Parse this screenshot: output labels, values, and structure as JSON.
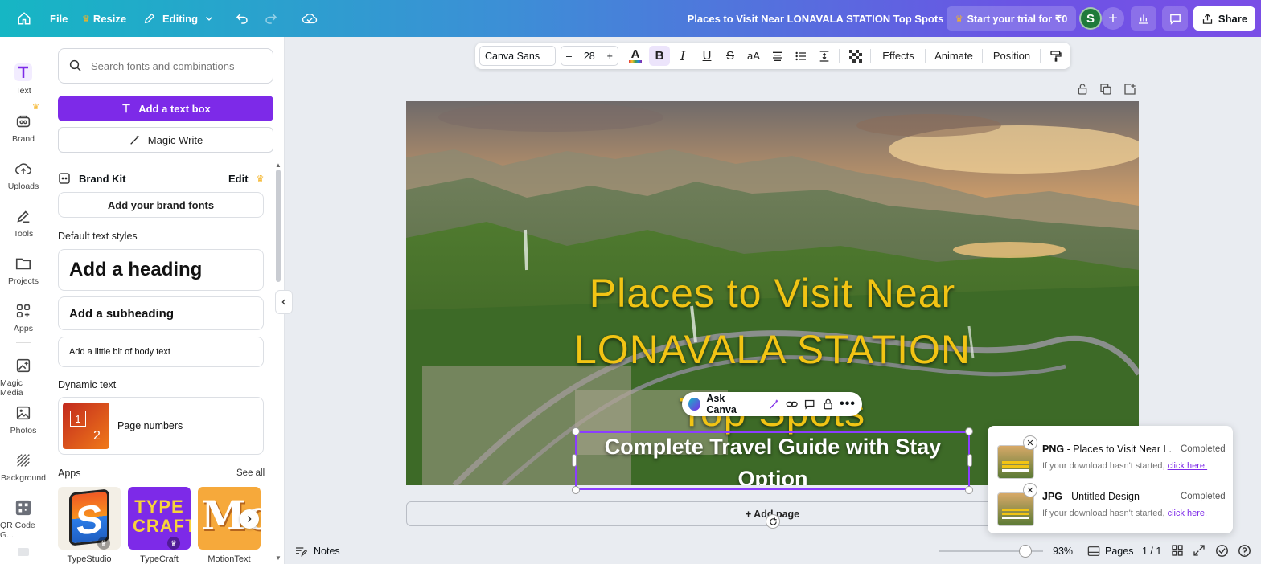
{
  "topbar": {
    "file_label": "File",
    "resize_label": "Resize",
    "editing_label": "Editing",
    "doc_title": "Places to Visit Near LONAVALA STATION Top Spots",
    "trial_label": "Start your trial for ₹0",
    "avatar_letter": "S",
    "share_label": "Share"
  },
  "rail": {
    "items": [
      {
        "label": "Text",
        "icon": "text-icon"
      },
      {
        "label": "Brand",
        "icon": "brand-icon"
      },
      {
        "label": "Uploads",
        "icon": "upload-icon"
      },
      {
        "label": "Tools",
        "icon": "tools-icon"
      },
      {
        "label": "Projects",
        "icon": "folder-icon"
      },
      {
        "label": "Apps",
        "icon": "apps-icon"
      },
      {
        "label": "Magic Media",
        "icon": "magic-media-icon"
      },
      {
        "label": "Photos",
        "icon": "photo-icon"
      },
      {
        "label": "Background",
        "icon": "background-icon"
      },
      {
        "label": "QR Code G...",
        "icon": "qr-code-icon"
      }
    ]
  },
  "panel": {
    "search_placeholder": "Search fonts and combinations",
    "add_text_box": "Add a text box",
    "magic_write": "Magic Write",
    "brand_kit_label": "Brand Kit",
    "brand_kit_edit": "Edit",
    "add_brand_fonts": "Add your brand fonts",
    "default_styles_label": "Default text styles",
    "heading": "Add a heading",
    "subheading": "Add a subheading",
    "body_text": "Add a little bit of body text",
    "dynamic_text_label": "Dynamic text",
    "page_numbers": "Page numbers",
    "page_numbers_thumb_a": "1",
    "page_numbers_thumb_b": "2",
    "apps_label": "Apps",
    "see_all": "See all",
    "apps": [
      {
        "name": "TypeStudio",
        "art": "S"
      },
      {
        "name": "TypeCraft",
        "art": "TYPE CRAFT"
      },
      {
        "name": "MotionText",
        "art": "Mo"
      }
    ]
  },
  "toolbar": {
    "font_name": "Canva Sans",
    "font_size": "28",
    "minus": "–",
    "plus": "+",
    "text_color_glyph": "A",
    "bold_glyph": "B",
    "italic_glyph": "I",
    "underline_glyph": "U",
    "strike_glyph": "S",
    "case_glyph": "aA",
    "effects": "Effects",
    "animate": "Animate",
    "position": "Position"
  },
  "canvas": {
    "headline_line1": "Places to Visit Near",
    "headline_line2": "LONAVALA STATION",
    "headline_line3": "Top Spots",
    "subtitle": "Complete Travel Guide with Stay Option",
    "ask_canva": "Ask Canva",
    "add_page": "+ Add page"
  },
  "bottombar": {
    "notes": "Notes",
    "zoom_percent": "93%",
    "zoom_level": 0.93,
    "pages_label": "Pages",
    "page_count": "1 / 1"
  },
  "downloads": [
    {
      "format": "PNG",
      "name": " - Places to Visit Near L...",
      "status": "Completed",
      "note": "If your download hasn't started,",
      "link": "click here."
    },
    {
      "format": "JPG",
      "name": " - Untitled Design",
      "status": "Completed",
      "note": "If your download hasn't started,",
      "link": "click here."
    }
  ],
  "colors": {
    "accent": "#7d2ae8",
    "headline": "#f2c414",
    "crown": "#f5b324"
  }
}
